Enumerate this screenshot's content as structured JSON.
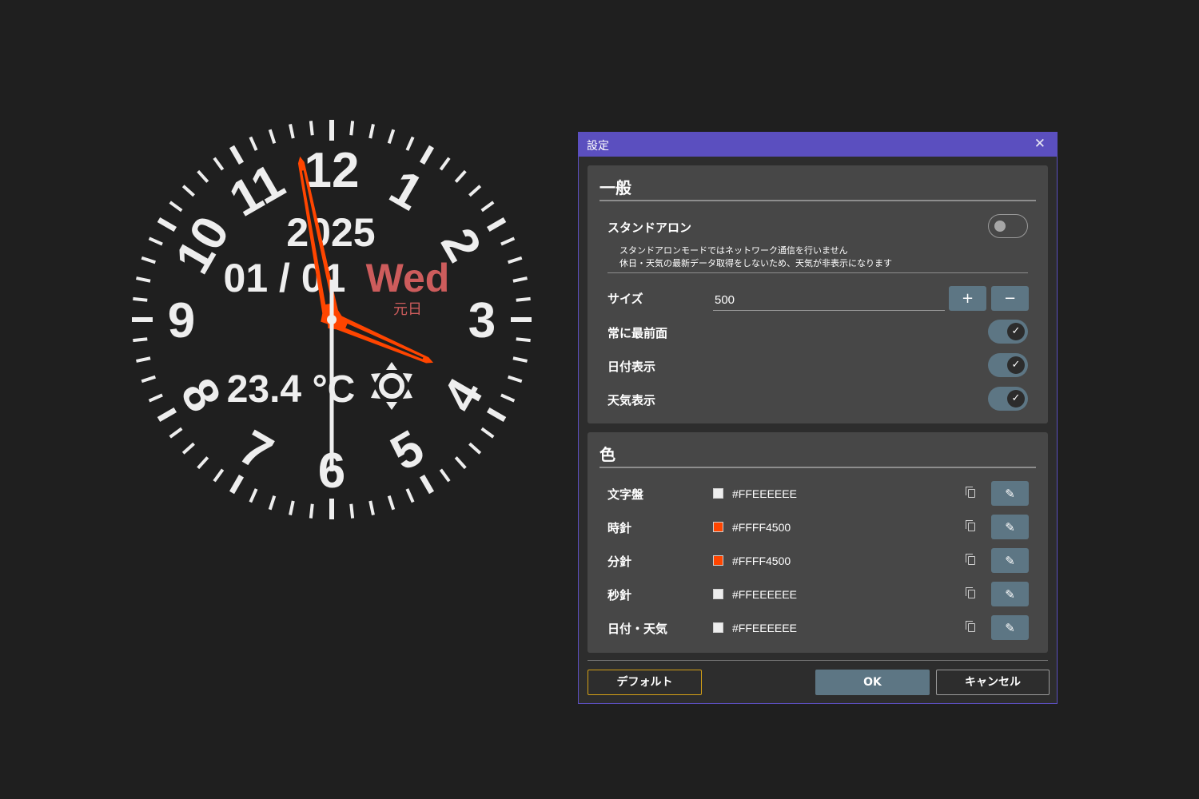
{
  "clock": {
    "numerals": [
      "12",
      "1",
      "2",
      "3",
      "4",
      "5",
      "6",
      "7",
      "8",
      "9",
      "10",
      "11"
    ],
    "year": "2025",
    "date": "01 / 01",
    "weekday": "Wed",
    "holiday": "元日",
    "temperature": "23.4 °C",
    "weather_icon": "sun-icon",
    "hand_color": "#FF4500",
    "face_color": "#EEEEEE",
    "accent_red": "#CD5C5C"
  },
  "dialog": {
    "title": "設定",
    "close_glyph": "✕",
    "general": {
      "heading": "一般",
      "standalone_label": "スタンドアロン",
      "standalone_on": false,
      "standalone_desc1": "スタンドアロンモードではネットワーク通信を行いません",
      "standalone_desc2": "休日・天気の最新データ取得をしないため、天気が非表示になります",
      "size_label": "サイズ",
      "size_value": "500",
      "plus": "+",
      "minus": "−",
      "topmost_label": "常に最前面",
      "topmost_on": true,
      "date_label": "日付表示",
      "date_on": true,
      "weather_label": "天気表示",
      "weather_on": true
    },
    "colors": {
      "heading": "色",
      "rows": [
        {
          "label": "文字盤",
          "hex": "#FFEEEEEE",
          "swatch": "#EEEEEE"
        },
        {
          "label": "時針",
          "hex": "#FFFF4500",
          "swatch": "#FF4500"
        },
        {
          "label": "分針",
          "hex": "#FFFF4500",
          "swatch": "#FF4500"
        },
        {
          "label": "秒針",
          "hex": "#FFEEEEEE",
          "swatch": "#EEEEEE"
        },
        {
          "label": "日付・天気",
          "hex": "#FFEEEEEE",
          "swatch": "#EEEEEE"
        }
      ]
    },
    "footer": {
      "default_label": "デフォルト",
      "ok_label": "OK",
      "cancel_label": "キャンセル"
    }
  }
}
